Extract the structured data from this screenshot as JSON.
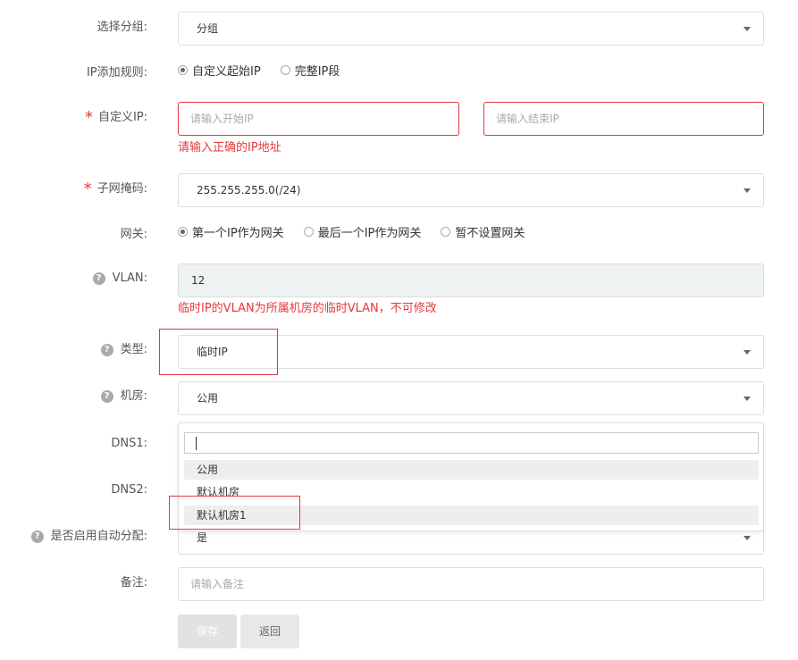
{
  "form": {
    "group": {
      "label": "选择分组:",
      "value": "分组"
    },
    "ip_rule": {
      "label": "IP添加规则:",
      "options": [
        "自定义起始IP",
        "完整IP段"
      ],
      "selected": 0
    },
    "custom_ip": {
      "label": "自定义IP:",
      "start_placeholder": "请输入开始IP",
      "end_placeholder": "请输入结束IP",
      "error": "请输入正确的IP地址"
    },
    "subnet_mask": {
      "label": "子网掩码:",
      "value": "255.255.255.0(/24)"
    },
    "gateway": {
      "label": "网关:",
      "options": [
        "第一个IP作为网关",
        "最后一个IP作为网关",
        "暂不设置网关"
      ],
      "selected": 0
    },
    "vlan": {
      "label": "VLAN:",
      "value": "12",
      "note": "临时IP的VLAN为所属机房的临时VLAN，不可修改"
    },
    "type": {
      "label": "类型:",
      "value": "临时IP"
    },
    "room": {
      "label": "机房:",
      "value": "公用",
      "dropdown": {
        "search_value": "",
        "options": [
          "公用",
          "默认机房",
          "默认机房1"
        ],
        "hover_index": 0,
        "highlighted_index": 2
      }
    },
    "dns1": {
      "label": "DNS1:"
    },
    "dns2": {
      "label": "DNS2:"
    },
    "auto_assign": {
      "label": "是否启用自动分配:",
      "value": "是"
    },
    "remark": {
      "label": "备注:",
      "placeholder": "请输入备注"
    }
  },
  "buttons": {
    "save": "保存",
    "back": "返回"
  },
  "colors": {
    "error": "#e4393c",
    "border": "#dddddd",
    "disabled_bg": "#eef2f2"
  },
  "icons": {
    "help": "?"
  }
}
